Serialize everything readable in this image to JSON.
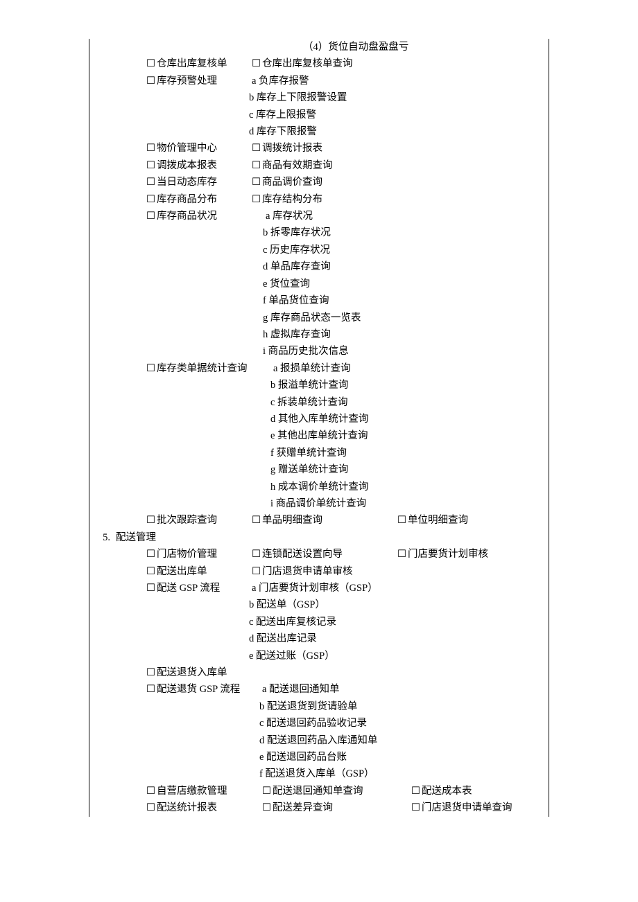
{
  "top_line": "（4）货位自动盘盈盘亏",
  "warehouse": {
    "l1a": "仓库出库复核单",
    "l1b": "仓库出库复核单查询",
    "l2": "库存预警处理",
    "l2a": "a 负库存报警",
    "l2b": "b 库存上下限报警设置",
    "l2c": "c 库存上限报警",
    "l2d": "d 库存下限报警",
    "l3a": "物价管理中心",
    "l3b": "调拨统计报表",
    "l4a": "调拨成本报表",
    "l4b": "商品有效期查询",
    "l5a": "当日动态库存",
    "l5b": "商品调价查询",
    "l6a": "库存商品分布",
    "l6b": "库存结构分布",
    "l7": "库存商品状况",
    "l7a": "a 库存状况",
    "l7b": "b 拆零库存状况",
    "l7c": "c 历史库存状况",
    "l7d": "d 单品库存查询",
    "l7e": "e 货位查询",
    "l7f": "f 单品货位查询",
    "l7g": "g 库存商品状态一览表",
    "l7h": "h 虚拟库存查询",
    "l7i": "i 商品历史批次信息",
    "l8": "库存类单据统计查询",
    "l8a": "a 报损单统计查询",
    "l8b": "b 报溢单统计查询",
    "l8c": "c 拆装单统计查询",
    "l8d": "d 其他入库单统计查询",
    "l8e": "e 其他出库单统计查询",
    "l8f": "f 获赠单统计查询",
    "l8g": "g 赠送单统计查询",
    "l8h": "h 成本调价单统计查询",
    "l8i": "i 商品调价单统计查询",
    "l9a": "批次跟踪查询",
    "l9b": "单品明细查询",
    "l9c": "单位明细查询"
  },
  "section5": {
    "num": "5.",
    "title": "配送管理",
    "r1a": "门店物价管理",
    "r1b": "连锁配送设置向导",
    "r1c": "门店要货计划审核",
    "r2a": "配送出库单",
    "r2b": "门店退货申请单审核",
    "r3": "配送 GSP 流程",
    "r3a": "a 门店要货计划审核（GSP）",
    "r3b": "b 配送单（GSP）",
    "r3c": "c 配送出库复核记录",
    "r3d": "d 配送出库记录",
    "r3e": "e 配送过账（GSP）",
    "r4": "配送退货入库单",
    "r5": "配送退货 GSP 流程",
    "r5a": "a 配送退回通知单",
    "r5b": "b 配送退货到货请验单",
    "r5c": "c 配送退回药品验收记录",
    "r5d": "d 配送退回药品入库通知单",
    "r5e": "e 配送退回药品台账",
    "r5f": "f 配送退货入库单（GSP）",
    "r6a": "自营店缴款管理",
    "r6b": "配送退回通知单查询",
    "r6c": "配送成本表",
    "r7a": "配送统计报表",
    "r7b": "配送差异查询",
    "r7c": "门店退货申请单查询"
  }
}
